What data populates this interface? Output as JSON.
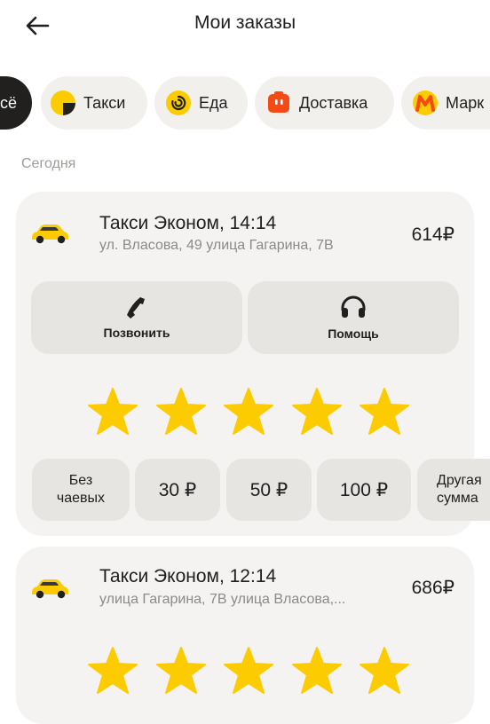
{
  "header": {
    "title": "Мои заказы"
  },
  "tabs": [
    {
      "label": "сё",
      "icon": "all-icon"
    },
    {
      "label": "Такси",
      "icon": "taxi-logo-icon"
    },
    {
      "label": "Еда",
      "icon": "eda-logo-icon"
    },
    {
      "label": "Доставка",
      "icon": "delivery-logo-icon"
    },
    {
      "label": "Марк",
      "icon": "market-logo-icon"
    }
  ],
  "section": {
    "label": "Сегодня"
  },
  "orders": [
    {
      "title": "Такси Эконом, 14:14",
      "address": "ул. Власова, 49 улица Гагарина, 7В",
      "price": "614₽",
      "call_label": "Позвонить",
      "help_label": "Помощь",
      "rating": 5,
      "tips": [
        "Без чаевых",
        "30 ₽",
        "50 ₽",
        "100 ₽",
        "Другая сумма"
      ]
    },
    {
      "title": "Такси Эконом, 12:14",
      "address": "улица Гагарина, 7В улица Власова,...",
      "price": "686₽",
      "rating": 5
    }
  ],
  "colors": {
    "accent_yellow": "#fccb00",
    "chip_bg": "#f1f0ed",
    "card_bg": "#f4f3f1",
    "button_bg": "#e6e5e2",
    "active_chip": "#21201f"
  }
}
